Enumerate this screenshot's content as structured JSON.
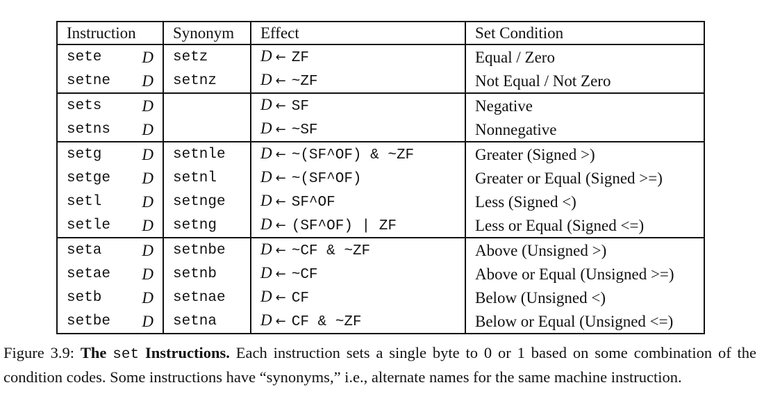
{
  "table": {
    "headers": {
      "instruction": "Instruction",
      "synonym": "Synonym",
      "effect": "Effect",
      "set_condition": "Set Condition"
    },
    "rows": [
      {
        "mnemonic": "sete",
        "operand": "D",
        "synonym": "setz",
        "dest": "D",
        "arrow": "←",
        "expr": "ZF",
        "condition": "Equal / Zero",
        "group_end": false
      },
      {
        "mnemonic": "setne",
        "operand": "D",
        "synonym": "setnz",
        "dest": "D",
        "arrow": "←",
        "expr": "~ZF",
        "condition": "Not Equal / Not Zero",
        "group_end": true
      },
      {
        "mnemonic": "sets",
        "operand": "D",
        "synonym": "",
        "dest": "D",
        "arrow": "←",
        "expr": "SF",
        "condition": "Negative",
        "group_end": false
      },
      {
        "mnemonic": "setns",
        "operand": "D",
        "synonym": "",
        "dest": "D",
        "arrow": "←",
        "expr": "~SF",
        "condition": "Nonnegative",
        "group_end": true
      },
      {
        "mnemonic": "setg",
        "operand": "D",
        "synonym": "setnle",
        "dest": "D",
        "arrow": "←",
        "expr": "~(SF^OF) & ~ZF",
        "condition": "Greater (Signed >)",
        "group_end": false
      },
      {
        "mnemonic": "setge",
        "operand": "D",
        "synonym": "setnl",
        "dest": "D",
        "arrow": "←",
        "expr": "~(SF^OF)",
        "condition": "Greater or Equal (Signed >=)",
        "group_end": false
      },
      {
        "mnemonic": "setl",
        "operand": "D",
        "synonym": "setnge",
        "dest": "D",
        "arrow": "←",
        "expr": "SF^OF",
        "condition": "Less (Signed <)",
        "group_end": false
      },
      {
        "mnemonic": "setle",
        "operand": "D",
        "synonym": "setng",
        "dest": "D",
        "arrow": "←",
        "expr": "(SF^OF) | ZF",
        "condition": "Less or Equal (Signed <=)",
        "group_end": true
      },
      {
        "mnemonic": "seta",
        "operand": "D",
        "synonym": "setnbe",
        "dest": "D",
        "arrow": "←",
        "expr": "~CF & ~ZF",
        "condition": "Above (Unsigned >)",
        "group_end": false
      },
      {
        "mnemonic": "setae",
        "operand": "D",
        "synonym": "setnb",
        "dest": "D",
        "arrow": "←",
        "expr": "~CF",
        "condition": "Above or Equal (Unsigned >=)",
        "group_end": false
      },
      {
        "mnemonic": "setb",
        "operand": "D",
        "synonym": "setnae",
        "dest": "D",
        "arrow": "←",
        "expr": "CF",
        "condition": "Below (Unsigned <)",
        "group_end": false
      },
      {
        "mnemonic": "setbe",
        "operand": "D",
        "synonym": "setna",
        "dest": "D",
        "arrow": "←",
        "expr": "CF & ~ZF",
        "condition": "Below or Equal (Unsigned <=)",
        "group_end": false
      }
    ]
  },
  "caption": {
    "figure_label": "Figure 3.9:",
    "title_bold_1": "The",
    "title_mono": "set",
    "title_bold_2": "Instructions.",
    "body": "Each instruction sets a single byte to 0 or 1 based on some combination of the condition codes.  Some instructions have “synonyms,” i.e., alternate names for the same machine instruction."
  }
}
